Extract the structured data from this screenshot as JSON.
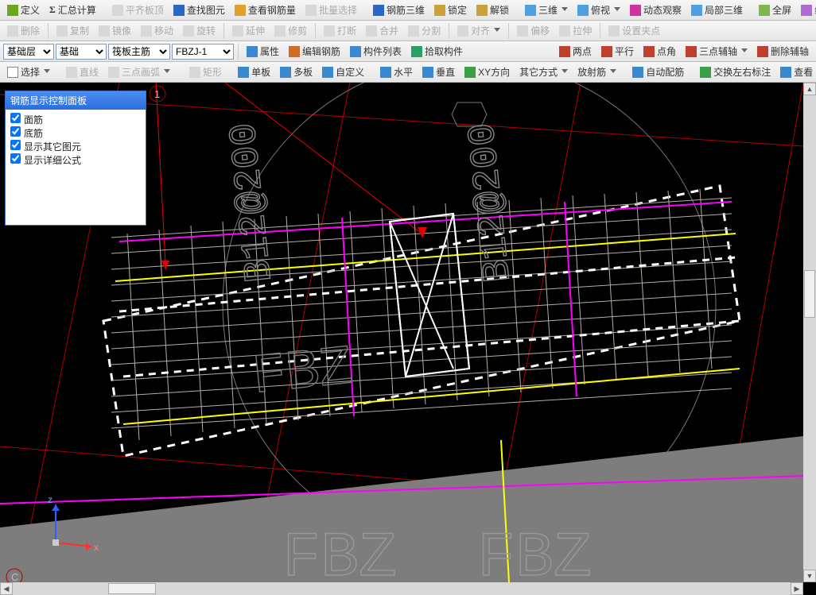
{
  "toolbar1": {
    "define": "定义",
    "sumcalc": "汇总计算",
    "align_slab_top": "平齐板顶",
    "find_element": "查找图元",
    "view_rebar_qty": "查看钢筋量",
    "batch_select": "批量选择",
    "rebar_3d": "钢筋三维",
    "lock": "锁定",
    "unlock": "解锁",
    "three_d": "三维",
    "top_view": "俯视",
    "dynamic_view": "动态观察",
    "local_3d": "局部三维",
    "fullscreen": "全屏",
    "zoom": "缩放"
  },
  "toolbar2": {
    "delete": "删除",
    "copy": "复制",
    "mirror": "镜像",
    "move": "移动",
    "rotate": "旋转",
    "extend": "延伸",
    "trim": "修剪",
    "break": "打断",
    "merge": "合并",
    "split": "分割",
    "align": "对齐",
    "offset": "偏移",
    "stretch": "拉伸",
    "set_grip": "设置夹点"
  },
  "toolbar3": {
    "select_floor": "基础层",
    "select_category": "基础",
    "select_sub": "筏板主筋",
    "select_item": "FBZJ-1",
    "properties": "属性",
    "edit_rebar": "编辑钢筋",
    "component_list": "构件列表",
    "pick_component": "拾取构件",
    "two_point": "两点",
    "parallel": "平行",
    "point_angle": "点角",
    "three_point_aux": "三点辅轴",
    "delete_aux": "删除辅轴"
  },
  "toolbar4": {
    "select": "选择",
    "line": "直线",
    "arc3pt": "三点画弧",
    "rect": "矩形",
    "single_board": "单板",
    "multi_board": "多板",
    "custom": "自定义",
    "horizontal": "水平",
    "vertical": "垂直",
    "xy_direction": "XY方向",
    "other_methods": "其它方式",
    "radial_rebar": "放射筋",
    "auto_rebar": "自动配筋",
    "swap_annotation": "交换左右标注",
    "view": "查看"
  },
  "panel": {
    "title": "钢筋显示控制面板",
    "item1": "面筋",
    "item2": "底筋",
    "item3": "显示其它图元",
    "item4": "显示详细公式"
  },
  "canvas_labels": [
    "1",
    "C",
    "FBZ",
    "B12@200",
    "B12@200"
  ],
  "axis": {
    "x": "x",
    "z": "z"
  }
}
